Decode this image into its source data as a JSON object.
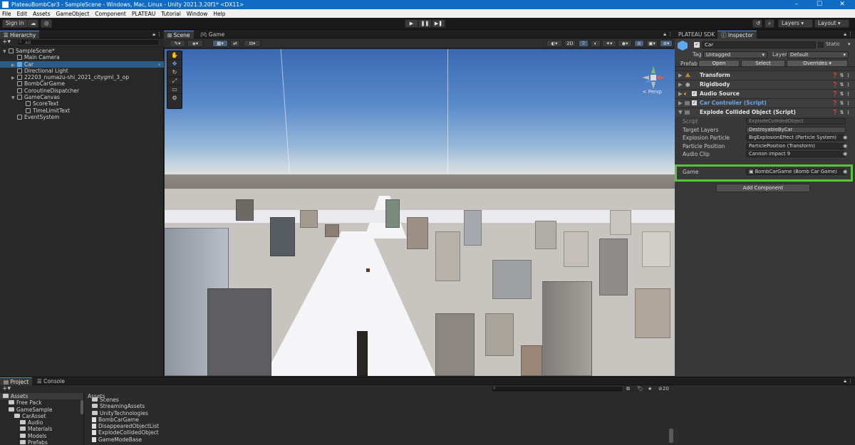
{
  "titlebar": {
    "title": "PlateauBombCar3 - SampleScene - Windows, Mac, Linux - Unity 2021.3.20f1* <DX11>"
  },
  "menu": [
    "File",
    "Edit",
    "Assets",
    "GameObject",
    "Component",
    "PLATEAU",
    "Tutorial",
    "Window",
    "Help"
  ],
  "toolbar": {
    "sign_in": "Sign in",
    "layers": "Layers",
    "layout": "Layout"
  },
  "hierarchy": {
    "tab": "Hierarchy",
    "search_placeholder": "All",
    "items": [
      {
        "label": "SampleScene*",
        "depth": 0,
        "kind": "scene",
        "expanded": true
      },
      {
        "label": "Main Camera",
        "depth": 1,
        "kind": "object"
      },
      {
        "label": "Car",
        "depth": 1,
        "kind": "prefab",
        "selected": true,
        "collapsed": true
      },
      {
        "label": "Directional Light",
        "depth": 1,
        "kind": "object"
      },
      {
        "label": "22203_numazu-shi_2021_citygml_3_op",
        "depth": 1,
        "kind": "object",
        "collapsed": true
      },
      {
        "label": "BombCarGame",
        "depth": 1,
        "kind": "object"
      },
      {
        "label": "CoroutineDispatcher",
        "depth": 1,
        "kind": "object"
      },
      {
        "label": "GameCanvas",
        "depth": 1,
        "kind": "object",
        "expanded": true
      },
      {
        "label": "ScoreText",
        "depth": 2,
        "kind": "object"
      },
      {
        "label": "TimeLimitText",
        "depth": 2,
        "kind": "object"
      },
      {
        "label": "EventSystem",
        "depth": 1,
        "kind": "object"
      }
    ]
  },
  "scene": {
    "tabs": [
      "Scene",
      "Game"
    ],
    "gizmo_label": "< Persp",
    "toolbar_number": "2D"
  },
  "inspector": {
    "tabs": [
      "PLATEAU SDK",
      "Inspector"
    ],
    "object_name": "Car",
    "static_label": "Static",
    "tag_label": "Tag",
    "tag_value": "Untagged",
    "layer_label": "Layer",
    "layer_value": "Default",
    "prefab_label": "Prefab",
    "prefab_open": "Open",
    "prefab_select": "Select",
    "prefab_overrides": "Overrides",
    "components": [
      "Transform",
      "Rigidbody",
      "Audio Source",
      "Car Controller (Script)",
      "Explode Collided Object (Script)"
    ],
    "properties": [
      {
        "label": "Script",
        "value": "ExplodeCollidedObject"
      },
      {
        "label": "Target Layers",
        "value": "DestroyableByCar"
      },
      {
        "label": "Explosion Particle",
        "value": "BigExplosionEffect (Particle System)"
      },
      {
        "label": "Particle Position",
        "value": "ParticlePosition (Transform)"
      },
      {
        "label": "Audio Clip",
        "value": "Cannon impact 9"
      }
    ],
    "game_label": "Game",
    "game_value": "BombCarGame (Bomb Car Game)",
    "add_component": "Add Component"
  },
  "project": {
    "tabs": [
      "Project",
      "Console"
    ],
    "tree": [
      {
        "label": "Assets",
        "depth": 0
      },
      {
        "label": "Free Pack",
        "depth": 1
      },
      {
        "label": "GameSample",
        "depth": 1
      },
      {
        "label": "CarAsset",
        "depth": 2
      },
      {
        "label": "Audio",
        "depth": 3
      },
      {
        "label": "Materials",
        "depth": 3
      },
      {
        "label": "Models",
        "depth": 3
      },
      {
        "label": "Prefabs",
        "depth": 3
      }
    ],
    "breadcrumb": "Assets",
    "hidden_count": "20",
    "files": [
      {
        "label": "Scenes",
        "kind": "folder"
      },
      {
        "label": "StreamingAssets",
        "kind": "folder"
      },
      {
        "label": "UnityTechnologies",
        "kind": "folder"
      },
      {
        "label": "BombCarGame",
        "kind": "file"
      },
      {
        "label": "DisappearedObjectList",
        "kind": "file"
      },
      {
        "label": "ExplodeCollidedObject",
        "kind": "file"
      },
      {
        "label": "GameModeBase",
        "kind": "file"
      }
    ]
  },
  "colors": {
    "accent": "#4a8cd8",
    "highlight": "#58c43b",
    "selection": "#2c5d87",
    "titlebar": "#0f6bc4"
  }
}
